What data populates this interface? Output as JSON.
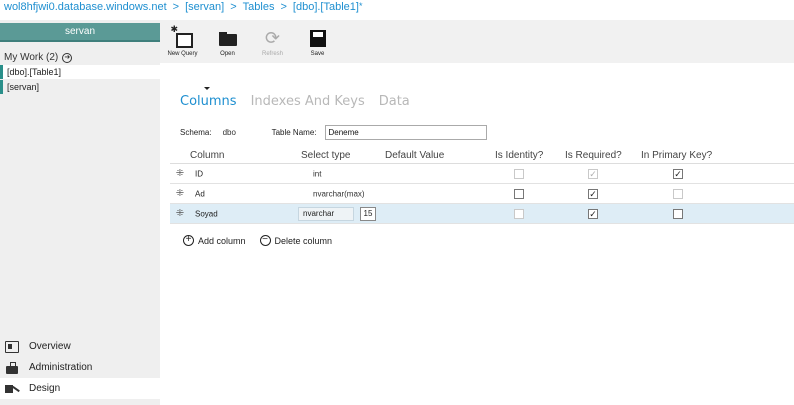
{
  "breadcrumb": {
    "server_host": "wol8hfjwi0.database.windows.net",
    "database": "[servan]",
    "section": "Tables",
    "table": "[dbo].[Table1]",
    "dirty_marker": "*",
    "separator": ">"
  },
  "sidebar": {
    "server_name": "servan",
    "my_work_label": "My Work (2)",
    "work_items": [
      {
        "label": "[dbo].[Table1]"
      },
      {
        "label": "[servan]"
      }
    ],
    "nav": [
      {
        "label": "Overview",
        "icon": "overview-icon"
      },
      {
        "label": "Administration",
        "icon": "administration-icon"
      },
      {
        "label": "Design",
        "icon": "design-icon"
      }
    ]
  },
  "toolbar": {
    "new_query": "New Query",
    "open": "Open",
    "refresh": "Refresh",
    "save": "Save"
  },
  "tabs": [
    "Columns",
    "Indexes And Keys",
    "Data"
  ],
  "schema_label": "Schema:",
  "schema_value": "dbo",
  "table_name_label": "Table Name:",
  "table_name_value": "Deneme",
  "grid": {
    "headers": {
      "column": "Column",
      "select_type": "Select type",
      "default_value": "Default Value",
      "is_identity": "Is Identity?",
      "is_required": "Is Required?",
      "primary_key": "In Primary Key?"
    },
    "rows": [
      {
        "name": "ID",
        "type": "int",
        "length": "",
        "is_identity": false,
        "is_required": true,
        "primary_key": true
      },
      {
        "name": "Ad",
        "type": "nvarchar(max)",
        "length": "",
        "is_identity": false,
        "is_required": true,
        "primary_key": false
      },
      {
        "name": "Soyad",
        "type": "nvarchar",
        "length": "15",
        "is_identity": false,
        "is_required": true,
        "primary_key": false
      }
    ]
  },
  "actions": {
    "add_column": "Add column",
    "delete_column": "Delete column"
  },
  "colors": {
    "accent": "#1e8fd0",
    "server_band": "#5b9a96",
    "selected_row": "#deedf6"
  }
}
